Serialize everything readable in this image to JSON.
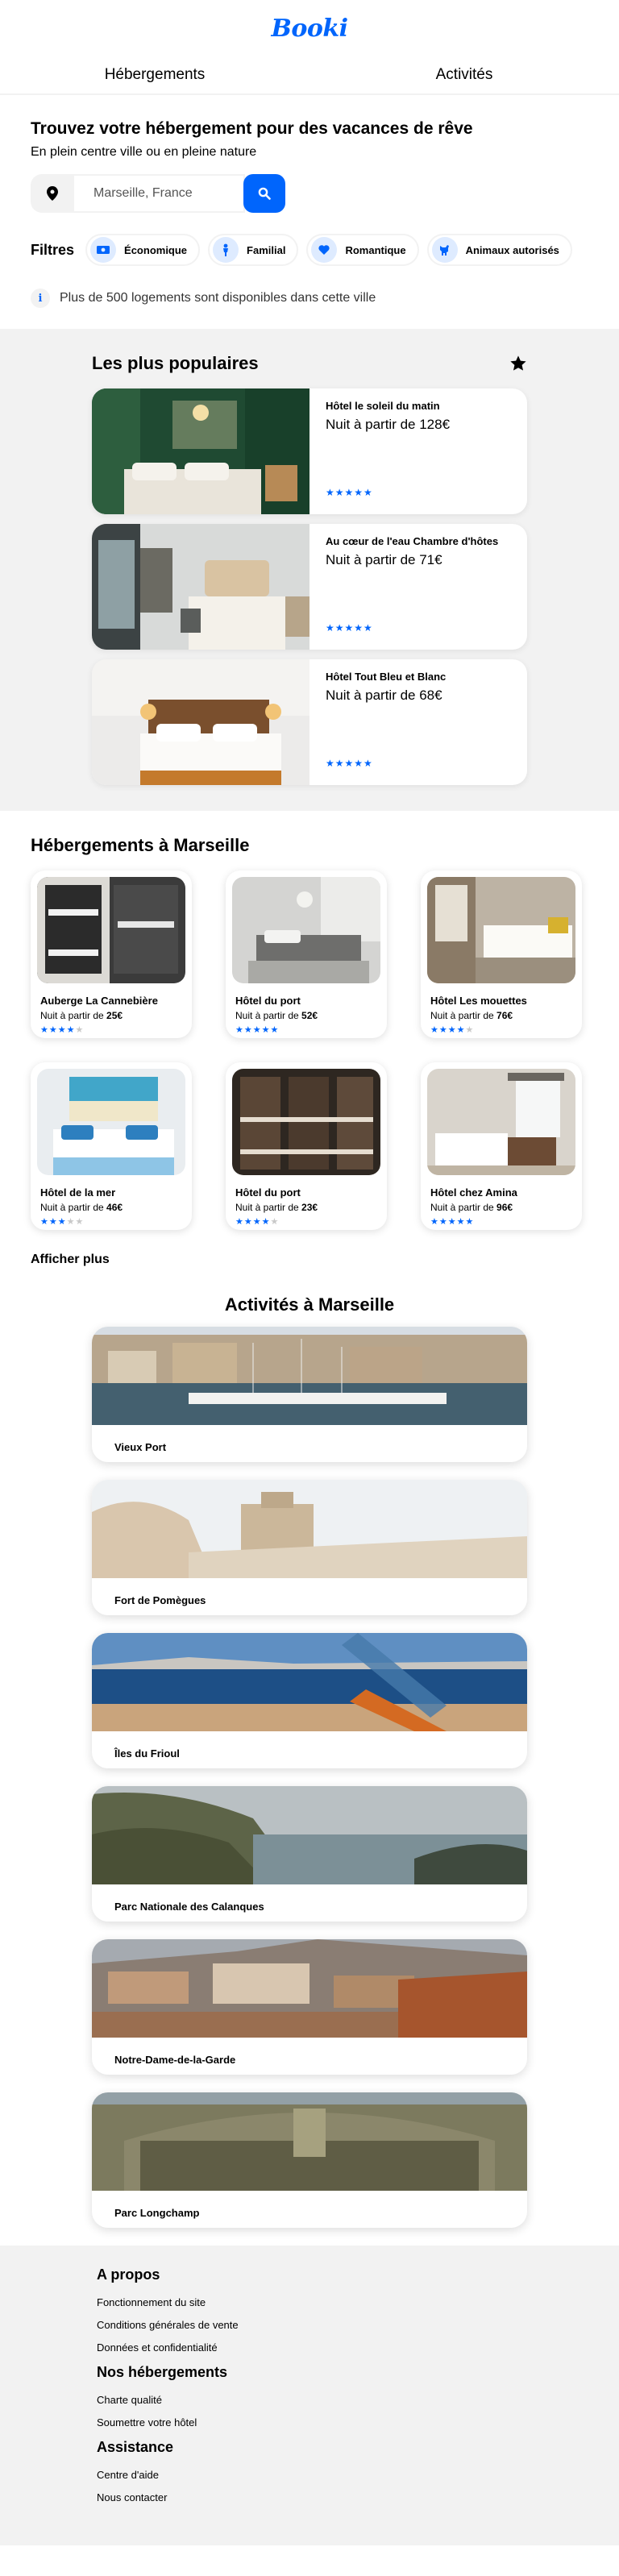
{
  "header": {
    "logo": "Booki"
  },
  "nav": {
    "items": [
      "Hébergements",
      "Activités"
    ]
  },
  "search": {
    "title": "Trouvez votre hébergement pour des vacances de rêve",
    "subtitle": "En plein centre ville ou en pleine nature",
    "placeholder": "Marseille, France"
  },
  "filters": {
    "label": "Filtres",
    "items": [
      {
        "label": "Économique",
        "icon": "money-icon"
      },
      {
        "label": "Familial",
        "icon": "child-icon"
      },
      {
        "label": "Romantique",
        "icon": "heart-icon"
      },
      {
        "label": "Animaux autorisés",
        "icon": "dog-icon"
      }
    ]
  },
  "info": {
    "text": "Plus de 500 logements sont disponibles dans cette ville"
  },
  "popular": {
    "title": "Les plus populaires",
    "items": [
      {
        "name": "Hôtel le soleil du matin",
        "price": "Nuit à partir de 128€",
        "stars": 5
      },
      {
        "name": "Au cœur de l'eau Chambre d'hôtes",
        "price": "Nuit à partir de 71€",
        "stars": 5
      },
      {
        "name": "Hôtel Tout Bleu et Blanc",
        "price": "Nuit à partir de 68€",
        "stars": 5
      }
    ]
  },
  "hebergements": {
    "title": "Hébergements à Marseille",
    "price_prefix": "Nuit à partir de ",
    "items": [
      {
        "name": "Auberge La Cannebière",
        "price": "25€",
        "stars": 4
      },
      {
        "name": "Hôtel du port",
        "price": "52€",
        "stars": 5
      },
      {
        "name": "Hôtel Les mouettes",
        "price": "76€",
        "stars": 4
      },
      {
        "name": "Hôtel de la mer",
        "price": "46€",
        "stars": 3
      },
      {
        "name": "Hôtel du port",
        "price": "23€",
        "stars": 4
      },
      {
        "name": "Hôtel chez Amina",
        "price": "96€",
        "stars": 5
      }
    ],
    "more": "Afficher plus"
  },
  "activites": {
    "title": "Activités à Marseille",
    "items": [
      "Vieux Port",
      "Fort de Pomègues",
      "Îles du Frioul",
      "Parc Nationale des Calanques",
      "Notre-Dame-de-la-Garde",
      "Parc Longchamp"
    ]
  },
  "footer": {
    "sections": [
      {
        "title": "A propos",
        "links": [
          "Fonctionnement du site",
          "Conditions générales de vente",
          "Données et confidentialité"
        ]
      },
      {
        "title": "Nos hébergements",
        "links": [
          "Charte qualité",
          "Soumettre votre hôtel"
        ]
      },
      {
        "title": "Assistance",
        "links": [
          "Centre d'aide",
          "Nous contacter"
        ]
      }
    ]
  },
  "colors": {
    "primary": "#0065FC",
    "light_blue": "#DEEBFF",
    "gray_bg": "#F2F2F2"
  }
}
